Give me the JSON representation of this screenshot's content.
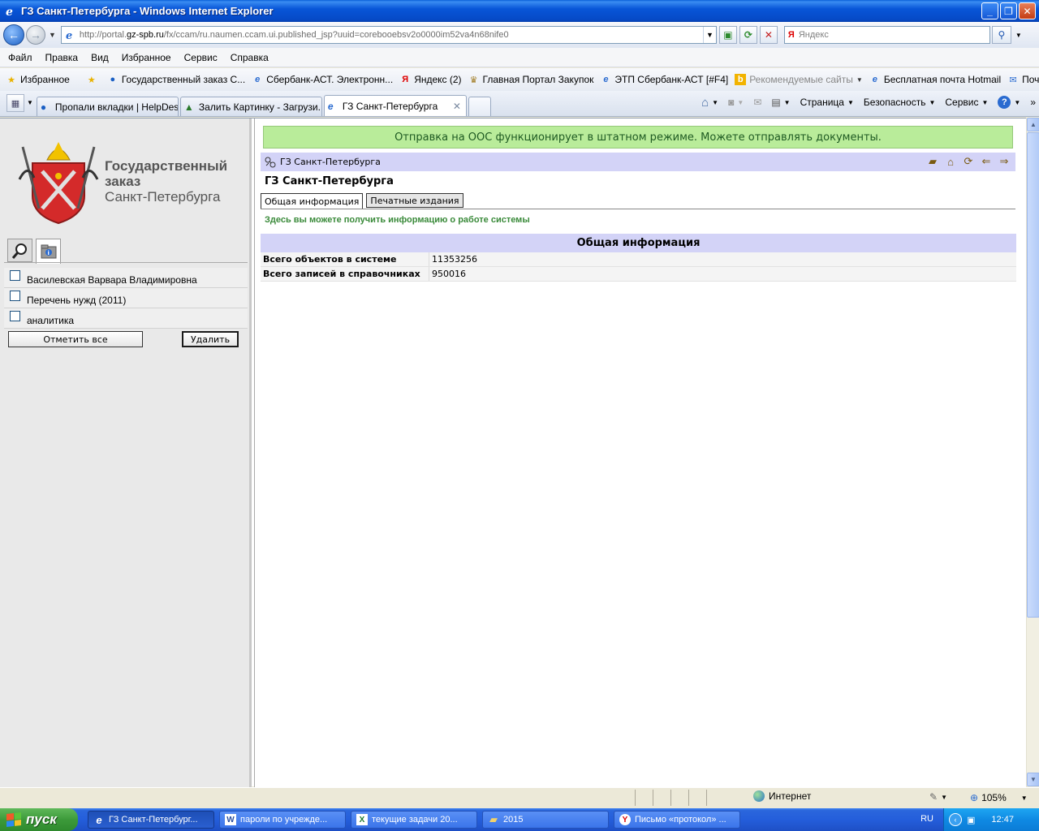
{
  "window": {
    "title": "ГЗ Санкт-Петербурга - Windows Internet Explorer"
  },
  "address": {
    "url_prefix": "http://portal.",
    "url_domain": "gz-spb.ru",
    "url_path": "/fx/ccam/ru.naumen.ccam.ui.published_jsp?uuid=corebooebsv2o0000im52va4n68nife0",
    "search_placeholder": "Яндекс",
    "search_logo": "Я"
  },
  "menu": [
    "Файл",
    "Правка",
    "Вид",
    "Избранное",
    "Сервис",
    "Справка"
  ],
  "favorites": {
    "label": "Избранное",
    "items": [
      "Государственный заказ С...",
      "Сбербанк-АСТ. Электронн...",
      "Яндекс (2)",
      "Главная Портал Закупок",
      "ЭТП Сбербанк-АСТ [#F4]",
      "Рекомендуемые сайты",
      "Бесплатная почта Hotmail",
      "Почта"
    ]
  },
  "tabs": [
    {
      "label": "Пропали вкладки | HelpDes..."
    },
    {
      "label": "Залить Картинку - Загрузи..."
    },
    {
      "label": "ГЗ Санкт-Петербурга"
    }
  ],
  "commands": {
    "page": "Страница",
    "security": "Безопасность",
    "service": "Сервис"
  },
  "left": {
    "logo_line1": "Государственный",
    "logo_line2": "заказ",
    "logo_line3": "Санкт-Петербурга",
    "items": [
      {
        "label": "Василевская Варвара Владимировна"
      },
      {
        "label": "Перечень нужд (2011)"
      },
      {
        "label": "аналитика"
      }
    ],
    "mark_all": "Отметить все",
    "delete": "Удалить"
  },
  "main": {
    "notice": "Отправка на ООС функционирует в штатном режиме. Можете отправлять документы.",
    "breadcrumb": "ГЗ Санкт-Петербурга",
    "title": "ГЗ Санкт-Петербурга",
    "tabs": [
      "Общая информация",
      "Печатные издания"
    ],
    "hint": "Здесь вы можете получить информацию о работе системы",
    "table_title": "Общая информация",
    "rows": [
      {
        "key": "Всего объектов в системе",
        "value": "11353256"
      },
      {
        "key": "Всего записей в справочниках",
        "value": "950016"
      }
    ]
  },
  "status": {
    "zone": "Интернет",
    "zoom": "105%"
  },
  "taskbar": {
    "start": "пуск",
    "tasks": [
      "ГЗ Санкт-Петербург...",
      "пароли по учрежде...",
      "текущие задачи 20...",
      "2015",
      "Письмо «протокол» ..."
    ],
    "lang": "RU",
    "clock": "12:47"
  },
  "colors": {
    "notice_bg": "#b9ec9a",
    "header_bg": "#d3d3f7",
    "hint_text": "#3a8a3a"
  }
}
